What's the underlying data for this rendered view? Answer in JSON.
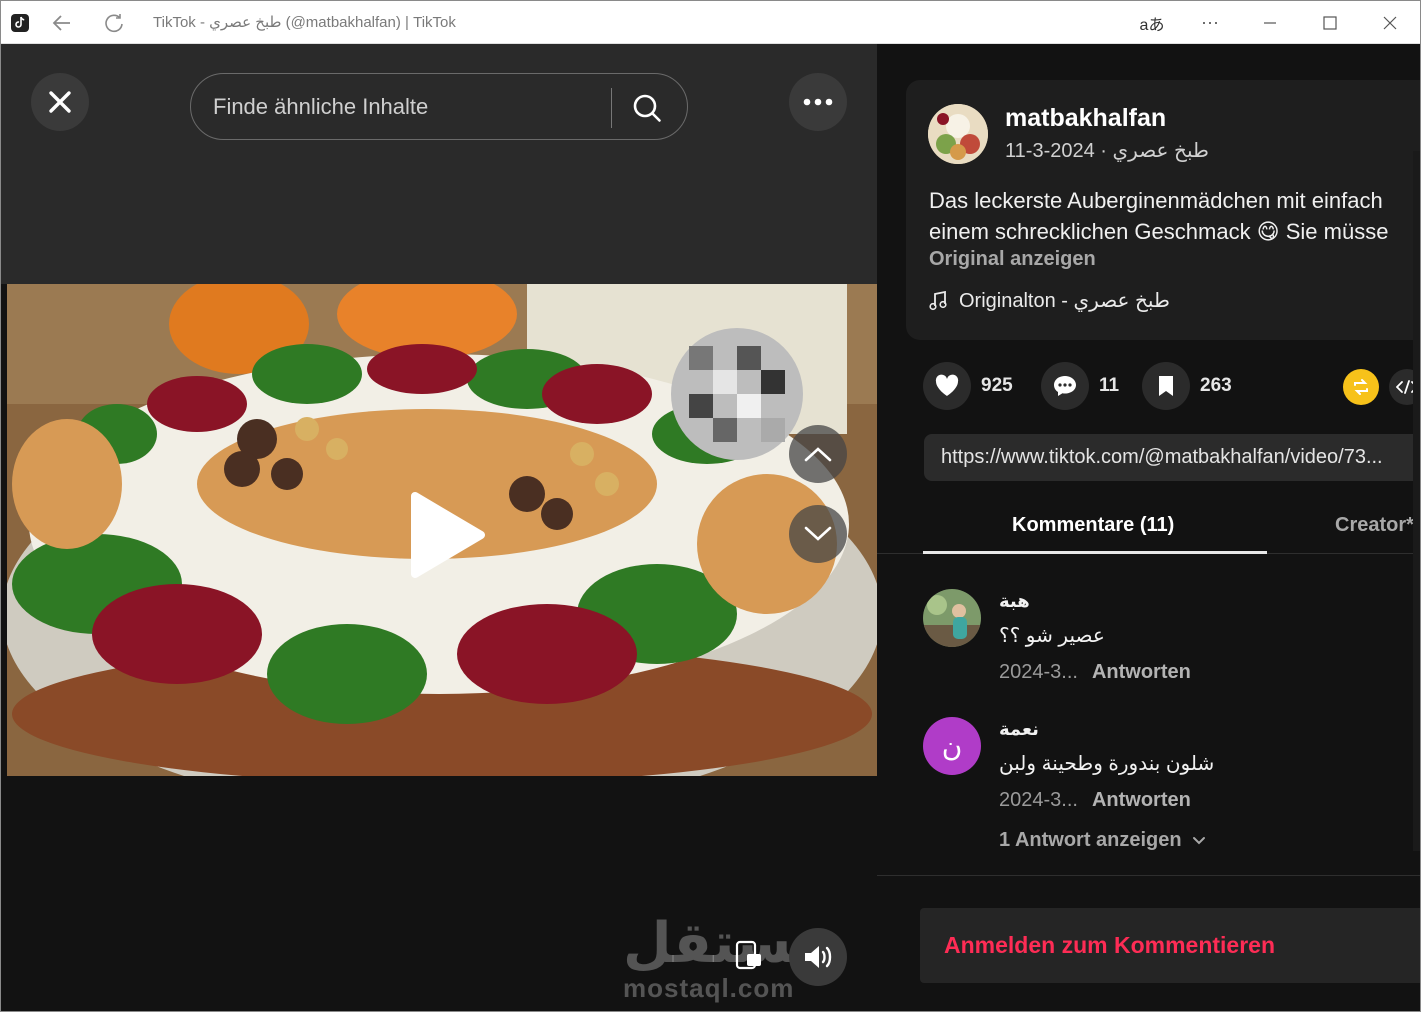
{
  "browser": {
    "title": "TikTok - طبخ عصري (@matbakhalfan) | TikTok",
    "reader_label": "aあ",
    "more_label": "···"
  },
  "player": {
    "search_placeholder": "Finde ähnliche Inhalte",
    "watermark_ar": "مستقل",
    "watermark_en": "mostaql.com"
  },
  "post": {
    "username": "matbakhalfan",
    "subline": "طبخ عصري · 2024-3-11",
    "description_line1": "Das leckerste Auberginenmädchen mit einfach",
    "description_line2": "einem schrecklichen Geschmack 😋 Sie müsse",
    "show_original": "Original anzeigen",
    "sound": "Originalton - طبخ عصري"
  },
  "actions": {
    "likes": "925",
    "comments": "11",
    "saves": "263"
  },
  "share": {
    "url": "https://www.tiktok.com/@matbakhalfan/video/73..."
  },
  "tabs": {
    "comments": "Kommentare (11)",
    "creator": "Creator*i"
  },
  "comments": [
    {
      "name": "هبة",
      "text": "عصير شو ؟؟",
      "date": "2024-3...",
      "reply": "Antworten",
      "avatar_letter": ""
    },
    {
      "name": "نعمة",
      "text": "شلون بندورة وطحينة ولبن",
      "date": "2024-3...",
      "reply": "Antworten",
      "avatar_letter": "ن"
    }
  ],
  "show_replies": "1 Antwort anzeigen",
  "login_prompt": "Anmelden zum Kommentieren",
  "colors": {
    "accent": "#fe2c55",
    "repost": "#f7c21a",
    "avatar_purple": "#b03cc8"
  }
}
